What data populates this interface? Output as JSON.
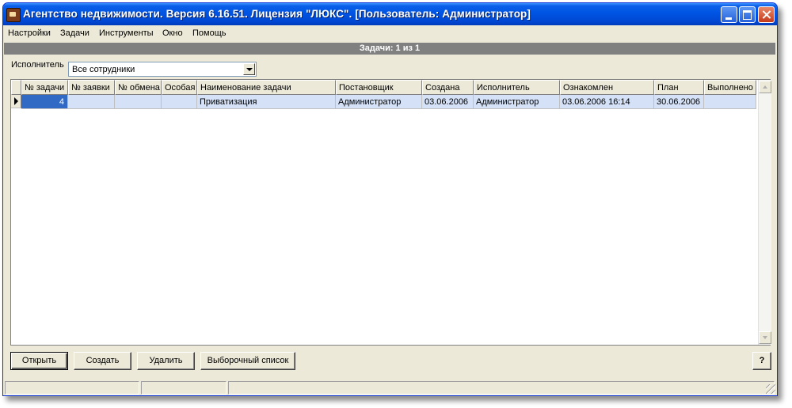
{
  "window": {
    "title": "Агентство недвижимости. Версия 6.16.51. Лицензия \"ЛЮКС\". [Пользователь: Администратор]"
  },
  "menu": [
    "Настройки",
    "Задачи",
    "Инструменты",
    "Окно",
    "Помощь"
  ],
  "status_band": "Задачи: 1 из 1",
  "filter": {
    "label": "Исполнитель",
    "value": "Все сотрудники"
  },
  "table": {
    "columns": [
      "№ задачи",
      "№ заявки",
      "№ обмена",
      "Особая",
      "Наименование задачи",
      "Постановщик",
      "Создана",
      "Исполнитель",
      "Ознакомлен",
      "План",
      "Выполнено"
    ],
    "rows": [
      [
        "4",
        "",
        "",
        "",
        "Приватизация",
        "Администратор",
        "03.06.2006",
        "Администратор",
        "03.06.2006 16:14",
        "30.06.2006",
        ""
      ]
    ]
  },
  "buttons": {
    "open": "Открыть",
    "create": "Создать",
    "delete": "Удалить",
    "selective_list": "Выборочный список",
    "help": "?"
  },
  "icons": {
    "app": "real-estate-app-icon",
    "minimize": "minimize-icon",
    "maximize": "maximize-icon",
    "close": "close-icon"
  }
}
